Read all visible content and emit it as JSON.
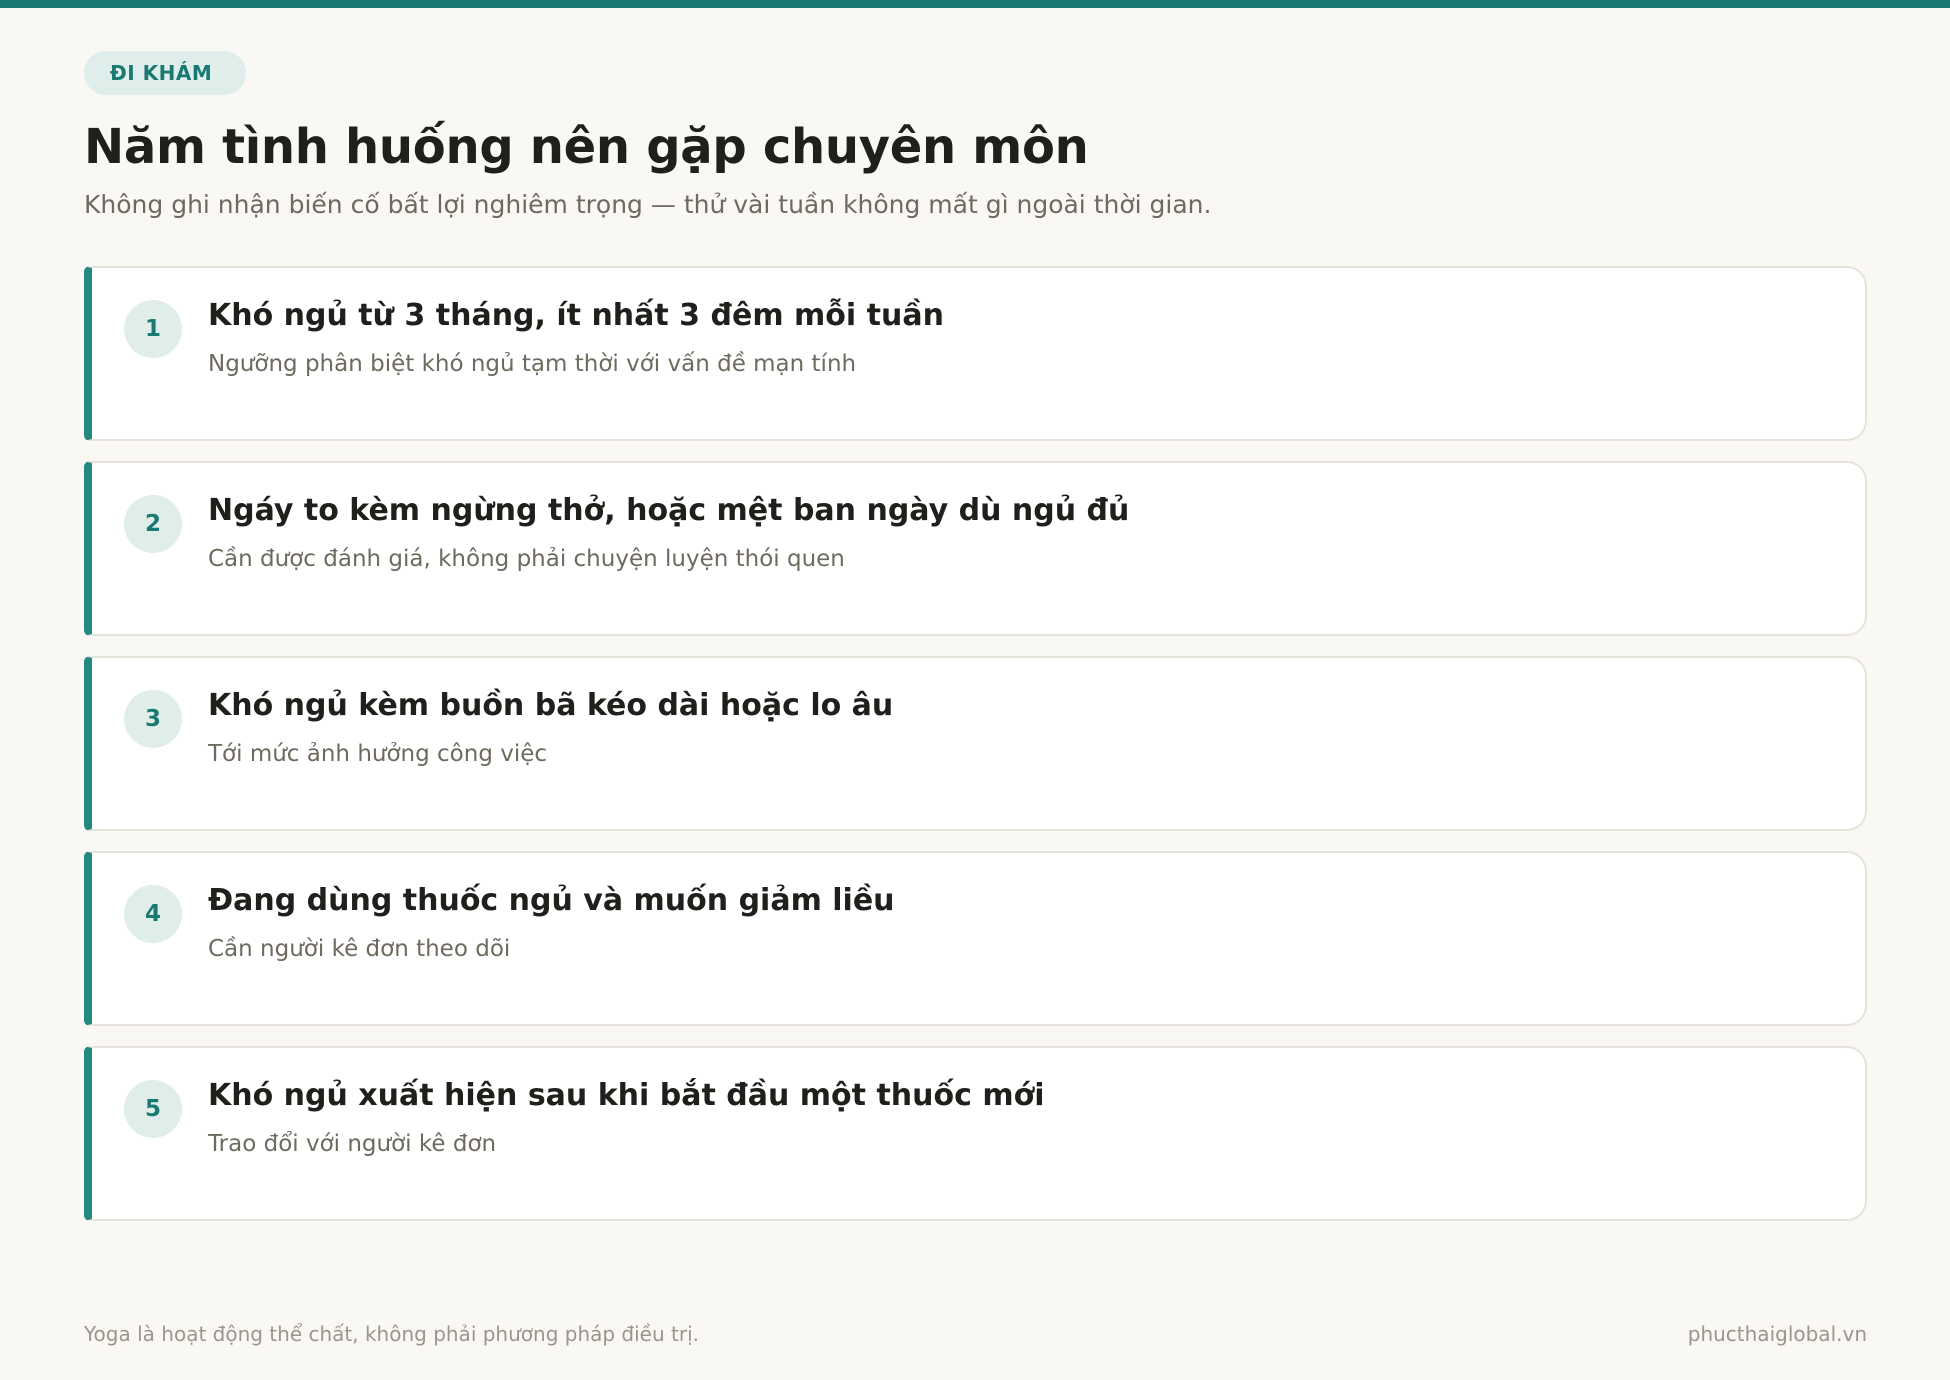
{
  "header": {
    "tag": "ĐI KHÁM",
    "title": "Năm tình huống nên gặp chuyên môn",
    "subtitle": "Không ghi nhận biến cố bất lợi nghiêm trọng — thử vài tuần không mất gì ngoài thời gian."
  },
  "items": [
    {
      "number": "1",
      "title": "Khó ngủ từ 3 tháng, ít nhất 3 đêm mỗi tuần",
      "description": "Ngưỡng phân biệt khó ngủ tạm thời với vấn đề mạn tính"
    },
    {
      "number": "2",
      "title": "Ngáy to kèm ngừng thở, hoặc mệt ban ngày dù ngủ đủ",
      "description": "Cần được đánh giá, không phải chuyện luyện thói quen"
    },
    {
      "number": "3",
      "title": "Khó ngủ kèm buồn bã kéo dài hoặc lo âu",
      "description": "Tới mức ảnh hưởng công việc"
    },
    {
      "number": "4",
      "title": "Đang dùng thuốc ngủ và muốn giảm liều",
      "description": "Cần người kê đơn theo dõi"
    },
    {
      "number": "5",
      "title": "Khó ngủ xuất hiện sau khi bắt đầu một thuốc mới",
      "description": "Trao đổi với người kê đơn"
    }
  ],
  "footer": {
    "note": "Yoga là hoạt động thể chất, không phải phương pháp điều trị.",
    "site": "phucthaiglobal.vn"
  },
  "colors": {
    "accent": "#1a7a73",
    "background": "#f9f8f4",
    "card_border_left": "#248a80"
  }
}
